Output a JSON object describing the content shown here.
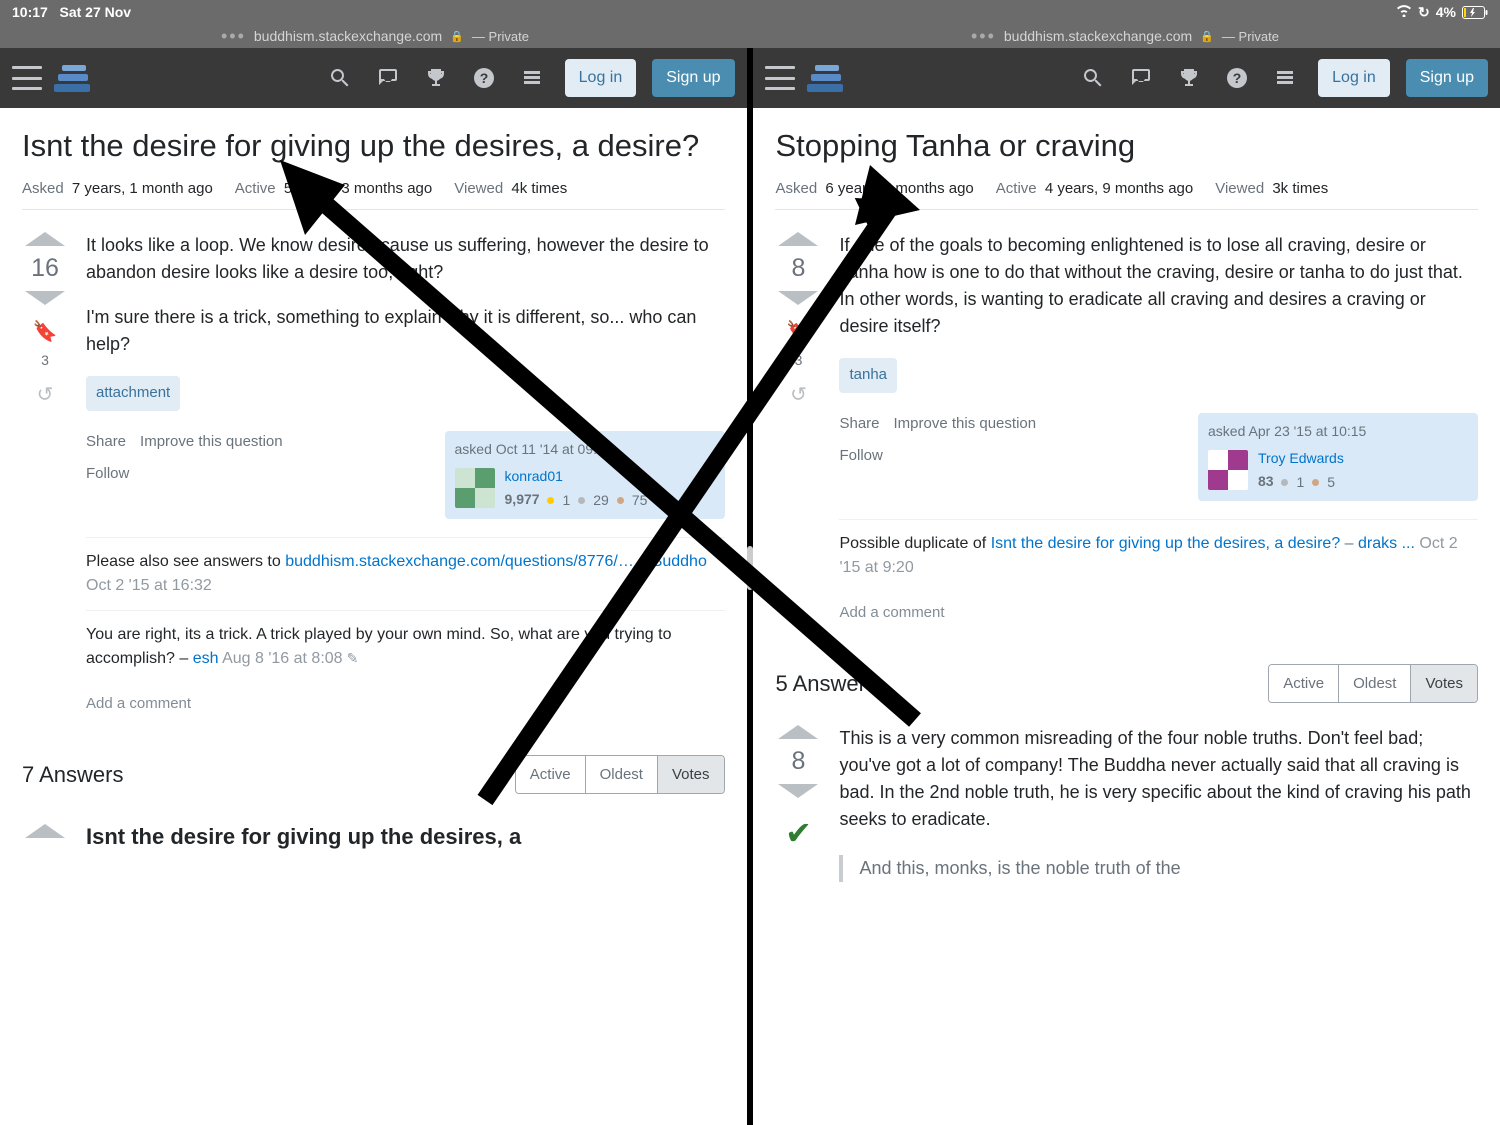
{
  "status": {
    "time": "10:17",
    "date": "Sat 27 Nov",
    "battery": "4%"
  },
  "tabs": {
    "url": "buddhism.stackexchange.com",
    "private": "— Private"
  },
  "nav": {
    "login": "Log in",
    "signup": "Sign up"
  },
  "left": {
    "title": "Isnt the desire for giving up the desires, a desire?",
    "asked_label": "Asked",
    "asked": "7 years, 1 month ago",
    "active_label": "Active",
    "active": "5 years, 3 months ago",
    "viewed_label": "Viewed",
    "viewed": "4k times",
    "vote": "16",
    "bookmarks": "3",
    "p1": "It looks like a loop. We know desires cause us suffering, however the desire to abandon desire looks like a desire too, right?",
    "p2": "I'm sure there is a trick, something to explain why it is different, so... who can help?",
    "tag": "attachment",
    "share": "Share",
    "improve": "Improve this question",
    "follow": "Follow",
    "asked_time": "asked Oct 11 '14 at 09:07",
    "user": "konrad01",
    "rep": "9,977",
    "gold": "1",
    "silver": "29",
    "bronze": "75",
    "c1_pre": "Please also see answers to ",
    "c1_link": "buddhism.stackexchange.com/questions/8776/…",
    "c1_user": "Buddho",
    "c1_time": "Oct 2 '15 at 16:32",
    "c2": "You are right, its a trick. A trick played by your own mind. So, what are you trying to accomplish? – ",
    "c2_user": "esh",
    "c2_time": "Aug 8 '16 at 8:08",
    "add_comment": "Add a comment",
    "answers_count": "7 Answers",
    "sort_active": "Active",
    "sort_oldest": "Oldest",
    "sort_votes": "Votes",
    "answer_title": "Isnt the desire for giving up the desires, a"
  },
  "right": {
    "title": "Stopping Tanha or craving",
    "asked_label": "Asked",
    "asked": "6 years, 7 months ago",
    "active_label": "Active",
    "active": "4 years, 9 months ago",
    "viewed_label": "Viewed",
    "viewed": "3k times",
    "vote": "8",
    "bookmarks": "3",
    "p1": "If one of the goals to becoming enlightened is to lose all craving, desire or Tanha how is one to do that without the craving, desire or tanha to do just that. In other words, is wanting to eradicate all craving and desires a craving or desire itself?",
    "tag": "tanha",
    "share": "Share",
    "improve": "Improve this question",
    "follow": "Follow",
    "asked_time": "asked Apr 23 '15 at 10:15",
    "user": "Troy Edwards",
    "rep": "83",
    "silver": "1",
    "bronze": "5",
    "dup_pre": "Possible duplicate of ",
    "dup_link": "Isnt the desire for giving up the desires, a desire?",
    "dup_user": "draks ...",
    "dup_time": "Oct 2 '15 at 9:20",
    "add_comment": "Add a comment",
    "answers_count": "5 Answers",
    "sort_active": "Active",
    "sort_oldest": "Oldest",
    "sort_votes": "Votes",
    "ans_vote": "8",
    "ans_p1": "This is a very common misreading of the four noble truths. Don't feel bad; you've got a lot of company! The Buddha never actually said that all craving is bad. In the 2nd noble truth, he is very specific about the kind of craving his path seeks to eradicate.",
    "ans_quote": "And this, monks, is the noble truth of the"
  }
}
